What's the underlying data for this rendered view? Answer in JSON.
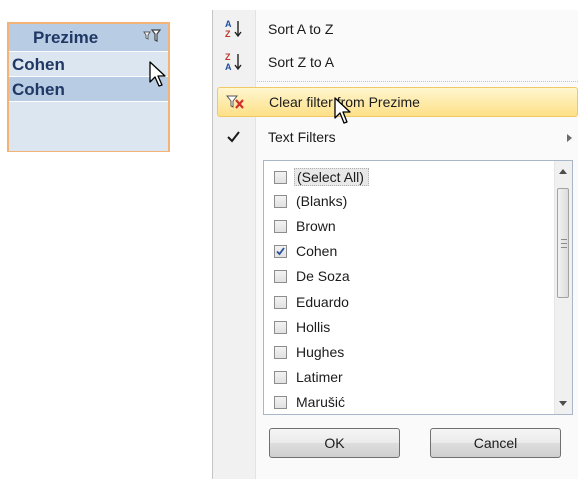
{
  "sheet": {
    "header": "Prezime",
    "rows": [
      "Cohen",
      "Cohen"
    ]
  },
  "menu": {
    "sort_az": "Sort A to Z",
    "sort_za": "Sort Z to A",
    "clear_filter": "Clear filter from Prezime",
    "text_filters": "Text Filters",
    "list": [
      {
        "label": "(Select All)",
        "checked": false
      },
      {
        "label": "(Blanks)",
        "checked": false
      },
      {
        "label": "Brown",
        "checked": false
      },
      {
        "label": "Cohen",
        "checked": true
      },
      {
        "label": "De Soza",
        "checked": false
      },
      {
        "label": "Eduardo",
        "checked": false
      },
      {
        "label": "Hollis",
        "checked": false
      },
      {
        "label": "Hughes",
        "checked": false
      },
      {
        "label": "Latimer",
        "checked": false
      },
      {
        "label": "Marušić",
        "checked": false
      }
    ],
    "ok": "OK",
    "cancel": "Cancel"
  },
  "colors": {
    "header_bg": "#b8cce4",
    "row_bg": "#dce6f1",
    "selection_border": "#f3b276",
    "highlight": "#fde087"
  }
}
